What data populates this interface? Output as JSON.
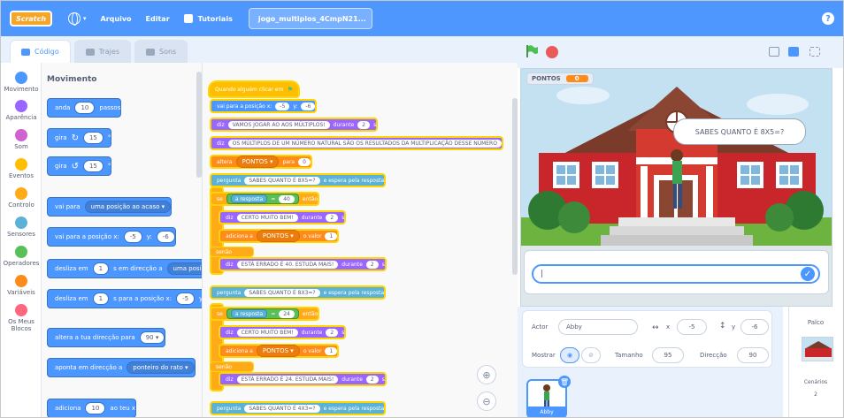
{
  "menubar": {
    "logo": "Scratch",
    "language_caret": "▾",
    "file": "Arquivo",
    "edit": "Editar",
    "tutorials": "Tutoriais",
    "project_title": "jogo_multiplos_4CmpN21...",
    "help": "?"
  },
  "tabs": {
    "code": "Código",
    "costumes": "Trajes",
    "sounds": "Sons"
  },
  "categories": [
    {
      "label": "Movimento",
      "color": "#4c97ff"
    },
    {
      "label": "Aparência",
      "color": "#9966ff"
    },
    {
      "label": "Som",
      "color": "#cf63cf"
    },
    {
      "label": "Eventos",
      "color": "#ffbf00"
    },
    {
      "label": "Controlo",
      "color": "#ffab19"
    },
    {
      "label": "Sensores",
      "color": "#5cb1d6"
    },
    {
      "label": "Operadores",
      "color": "#59c059"
    },
    {
      "label": "Variáveis",
      "color": "#ff8c1a"
    },
    {
      "label": "Os Meus Blocos",
      "color": "#ff6680"
    }
  ],
  "palette": {
    "title": "Movimento",
    "move": {
      "label": "anda",
      "value": "10",
      "suffix": "passos"
    },
    "turn_right": {
      "label": "gira",
      "value": "15",
      "suffix": "°"
    },
    "turn_left": {
      "label": "gira",
      "value": "15",
      "suffix": "°"
    },
    "goto": {
      "label": "vai para",
      "option": "uma posição ao acaso"
    },
    "goto_xy": {
      "label": "vai para a posição x:",
      "x": "-5",
      "y_label": "y:",
      "y": "-6"
    },
    "glide_to": {
      "label": "desliza em",
      "secs": "1",
      "middle": "s em direcção a",
      "option": "uma posição"
    },
    "glide_xy": {
      "label": "desliza em",
      "secs": "1",
      "middle": "s para a posição x:",
      "x": "-5",
      "y_label": "y:"
    },
    "point_dir": {
      "label": "altera a tua direcção para",
      "value": "90"
    },
    "point_towards": {
      "label": "aponta em direcção a",
      "option": "ponteiro do rato"
    },
    "change_x": {
      "label": "adiciona",
      "value": "10",
      "suffix": "ao teu x"
    }
  },
  "script": {
    "hat": "Quando alguém clicar em",
    "goto": {
      "label": "vai para a posição x:",
      "x": "-5",
      "y_label": "y:",
      "y": "-6"
    },
    "say1": {
      "label": "diz",
      "text": "VAMOS JOGAR AO AOS MÚLTIPLOS!",
      "during": "durante",
      "secs": "2",
      "s": "s"
    },
    "say2": {
      "label": "diz",
      "text": "OS MÚLTIPLOS DE UM NÚMERO NATURAL SÃO OS RESULTADOS DA MULTIPLICAÇÃO DESSE NÚMERO"
    },
    "set_points": {
      "label": "altera",
      "var": "PONTOS",
      "to": "para",
      "value": "0"
    },
    "ask1": {
      "label": "pergunta",
      "text": "SABES QUANTO É 8X5=?",
      "wait": "e espera pela resposta"
    },
    "if1": {
      "label": "se",
      "answer": "a resposta",
      "eq": "=",
      "value": "40",
      "then": "então"
    },
    "say_ok1": {
      "label": "diz",
      "text": "CERTO MUITO BEM!",
      "during": "durante",
      "secs": "2",
      "s": "s"
    },
    "add_points1": {
      "label": "adiciona a",
      "var": "PONTOS",
      "value_label": "o valor",
      "value": "1"
    },
    "else1": "senão",
    "say_wrong1": {
      "label": "diz",
      "text": "ESTÁ ERRADO É 40. ESTUDA MAIS!",
      "during": "durante",
      "secs": "2",
      "s": "s"
    },
    "ask2": {
      "label": "pergunta",
      "text": "SABES QUANTO É 8X3=?",
      "wait": "e espera pela resposta"
    },
    "if2": {
      "label": "se",
      "answer": "a resposta",
      "eq": "=",
      "value": "24",
      "then": "então"
    },
    "say_ok2": {
      "label": "diz",
      "text": "CERTO MUITO BEM!",
      "during": "durante",
      "secs": "2",
      "s": "s"
    },
    "add_points2": {
      "label": "adiciona a",
      "var": "PONTOS",
      "value_label": "o valor",
      "value": "1"
    },
    "else2": "senão",
    "say_wrong2": {
      "label": "diz",
      "text": "ESTÁ ERRADO É 24. ESTUDA MAIS!",
      "during": "durante",
      "secs": "2",
      "s": "s"
    },
    "ask3": {
      "label": "pergunta",
      "text": "SABES QUANTO É 4X3=?",
      "wait": "e espera pela resposta"
    }
  },
  "stage": {
    "monitor_label": "PONTOS",
    "monitor_value": "0",
    "speech": "SABES QUANTO É 8X5=?",
    "answer_value": "|"
  },
  "sprite_info": {
    "sprite_label": "Actor",
    "sprite_name": "Abby",
    "x_label": "x",
    "x": "-5",
    "y_label": "y",
    "y": "-6",
    "show_label": "Mostrar",
    "size_label": "Tamanho",
    "size": "95",
    "direction_label": "Direcção",
    "direction": "90",
    "thumb_name": "Abby"
  },
  "stage_pane": {
    "title": "Palco",
    "backdrops_label": "Cenários",
    "backdrops_count": "2"
  }
}
